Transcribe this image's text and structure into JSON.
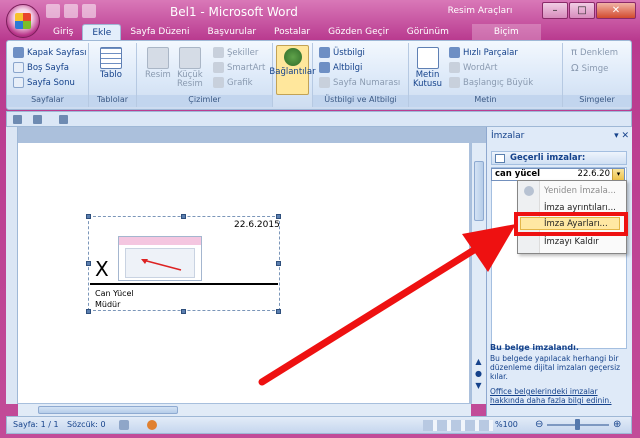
{
  "window": {
    "title": "Bel1 - Microsoft Word",
    "context_title": "Resim Araçları",
    "controls": {
      "minimize": "–",
      "maximize": "□",
      "close": "✕"
    }
  },
  "tabs": [
    {
      "label": "Giriş"
    },
    {
      "label": "Ekle"
    },
    {
      "label": "Sayfa Düzeni"
    },
    {
      "label": "Başvurular"
    },
    {
      "label": "Postalar"
    },
    {
      "label": "Gözden Geçir"
    },
    {
      "label": "Görünüm"
    },
    {
      "label": "Biçim"
    }
  ],
  "ribbon": {
    "sayfalar": {
      "label": "Sayfalar",
      "items": [
        "Kapak Sayfası",
        "Boş Sayfa",
        "Sayfa Sonu"
      ]
    },
    "tablolar": {
      "label": "Tablolar",
      "tablo": "Tablo"
    },
    "cizimler": {
      "label": "Çizimler",
      "resim": "Resim",
      "kucuk_resim_1": "Küçük",
      "kucuk_resim_2": "Resim",
      "sekiller": "Şekiller",
      "smartart": "SmartArt",
      "grafik": "Grafik"
    },
    "baglantilar": {
      "label": "Bağlantılar"
    },
    "ustbilgi": {
      "label": "Üstbilgi ve Altbilgi",
      "items": [
        "Üstbilgi",
        "Altbilgi",
        "Sayfa Numarası"
      ]
    },
    "metin": {
      "label": "Metin",
      "metin_kutusu_1": "Metin",
      "metin_kutusu_2": "Kutusu",
      "items": [
        "Hızlı Parçalar",
        "WordArt",
        "Başlangıç Büyük"
      ]
    },
    "simgeler": {
      "label": "Simgeler",
      "items": [
        "Denklem",
        "Simge"
      ]
    }
  },
  "document": {
    "signature": {
      "date": "22.6.2015",
      "x_mark": "X",
      "name": "Can Yücel",
      "role": "Müdür"
    }
  },
  "pane": {
    "title": "İmzalar",
    "controls": "▾ ✕",
    "valid_header": "Geçerli imzalar:",
    "signer": "can yücel",
    "signer_date": "22.6.20",
    "dropdown_glyph": "▾",
    "menu": [
      {
        "label": "Yeniden İmzala...",
        "enabled": false
      },
      {
        "label": "İmza ayrıntıları...",
        "enabled": true
      },
      {
        "label": "İmza Ayarları...",
        "enabled": true,
        "highlighted": true
      },
      {
        "label": "İmzayı Kaldır",
        "enabled": true
      }
    ],
    "footer": {
      "title": "Bu belge imzalandı.",
      "text": "Bu belgede yapılacak herhangi bir düzenleme dijital imzaları geçersiz kılar.",
      "link": "Office belgelerindeki imzalar hakkında daha fazla bilgi edinin."
    }
  },
  "status": {
    "page": "Sayfa: 1 / 1",
    "words": "Sözcük: 0",
    "zoom": "%100",
    "minus": "⊖",
    "plus": "⊕"
  },
  "colors": {
    "annotation_red": "#ee1111",
    "frame_pink": "#c24b98"
  }
}
